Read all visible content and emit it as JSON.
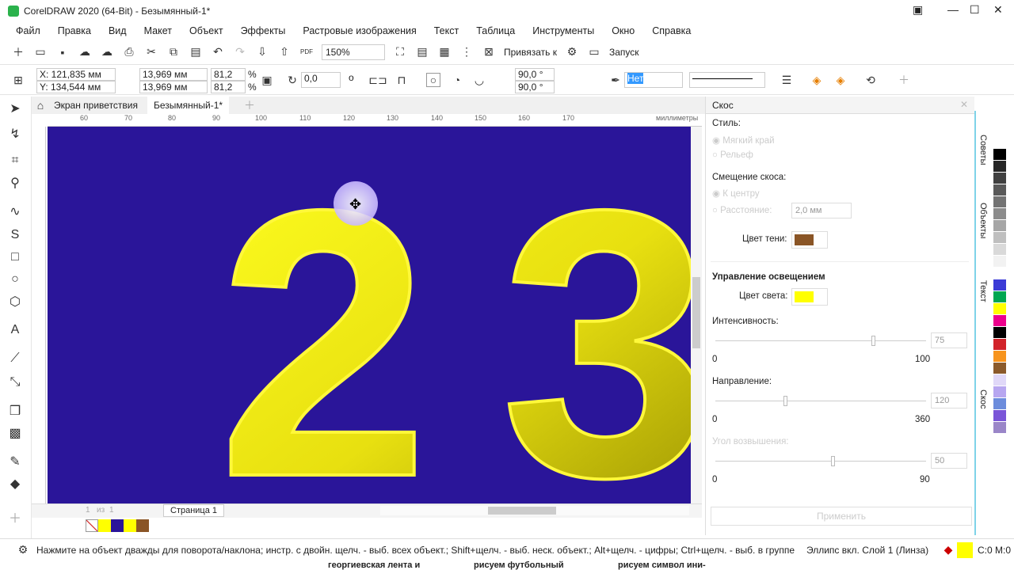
{
  "title": "CorelDRAW 2020 (64-Bit) - Безымянный-1*",
  "menu": [
    "Файл",
    "Правка",
    "Вид",
    "Макет",
    "Объект",
    "Эффекты",
    "Растровые изображения",
    "Текст",
    "Таблица",
    "Инструменты",
    "Окно",
    "Справка"
  ],
  "toolbar": {
    "zoom": "150%",
    "snap": "Привязать к",
    "launch": "Запуск"
  },
  "props": {
    "x": "X: 121,835 мм",
    "y": "Y: 134,544 мм",
    "w": "13,969 мм",
    "h": "13,969 мм",
    "sx": "81,2",
    "sy": "81,2",
    "pct": "%",
    "rot": "0,0",
    "deg": "o",
    "a1": "90,0 °",
    "a2": "90,0 °",
    "outline": "Нет"
  },
  "tabs": {
    "welcome": "Экран приветствия",
    "doc": "Безымянный-1*"
  },
  "ruler": {
    "ticks": [
      "60",
      "70",
      "80",
      "90",
      "100",
      "110",
      "120",
      "130",
      "140",
      "150",
      "160",
      "170"
    ],
    "unit": "миллиметры"
  },
  "canvas": {
    "text": "23",
    "bg": "#2a1599",
    "fg": "#f2ea10"
  },
  "page": {
    "label": "Страница 1",
    "of": "из",
    "num": "1"
  },
  "docker": {
    "title": "Скос",
    "style": "Стиль:",
    "soft": "Мягкий край",
    "relief": "Рельеф",
    "offset": "Смещение скоса:",
    "center": "К центру",
    "distance": "Расстояние:",
    "distance_val": "2,0 мм",
    "shadow": "Цвет тени:",
    "shadow_color": "#8a5526",
    "lighting": "Управление освещением",
    "light": "Цвет света:",
    "light_color": "#ffff00",
    "intensity": "Интенсивность:",
    "intensity_val": "75",
    "int_min": "0",
    "int_max": "100",
    "direction": "Направление:",
    "direction_val": "120",
    "dir_min": "0",
    "dir_max": "360",
    "elev": "Угол возвышения:",
    "elev_val": "50",
    "el_min": "0",
    "el_max": "90",
    "apply": "Применить"
  },
  "sidetabs": [
    "Советы",
    "Объекты",
    "Текст",
    "Скос"
  ],
  "palette": [
    "#000000",
    "#262626",
    "#404040",
    "#595959",
    "#737373",
    "#8c8c8c",
    "#a6a6a6",
    "#bfbfbf",
    "#d9d9d9",
    "#f2f2f2",
    "#ffffff",
    "#3b3bd6",
    "#00a651",
    "#ffff00",
    "#ec008c",
    "#000000",
    "#d2232a",
    "#f7941d",
    "#8b5a2b",
    "#e0d8f8",
    "#b7a6f0",
    "#6c8cdc",
    "#7a55d8",
    "#9a86c8"
  ],
  "status": {
    "hint": "Нажмите на объект дважды для поворота/наклона; инстр. с двойн. щелч. - выб. всех объект.; Shift+щелч. - выб. неск. объект.; Alt+щелч. - цифры; Ctrl+щелч. - выб. в группе",
    "object": "Эллипс вкл. Слой 1  (Линза)",
    "cmyk": "C:0 M:0"
  },
  "below": [
    "георгиевская лента и",
    "рисуем футбольный",
    "рисуем символ ини-"
  ]
}
